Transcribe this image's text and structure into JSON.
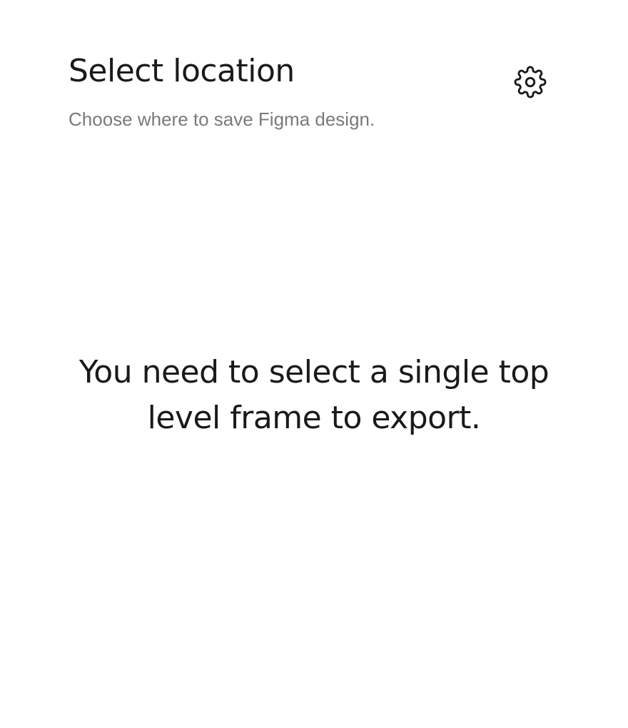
{
  "header": {
    "title": "Select location",
    "subtitle": "Choose where to save Figma design.",
    "settings_icon": "gear-icon"
  },
  "main": {
    "message": "You need to select a single top level frame to export."
  },
  "colors": {
    "text_primary": "#1a1a1a",
    "text_secondary": "#7a7a7a",
    "background": "#ffffff"
  }
}
